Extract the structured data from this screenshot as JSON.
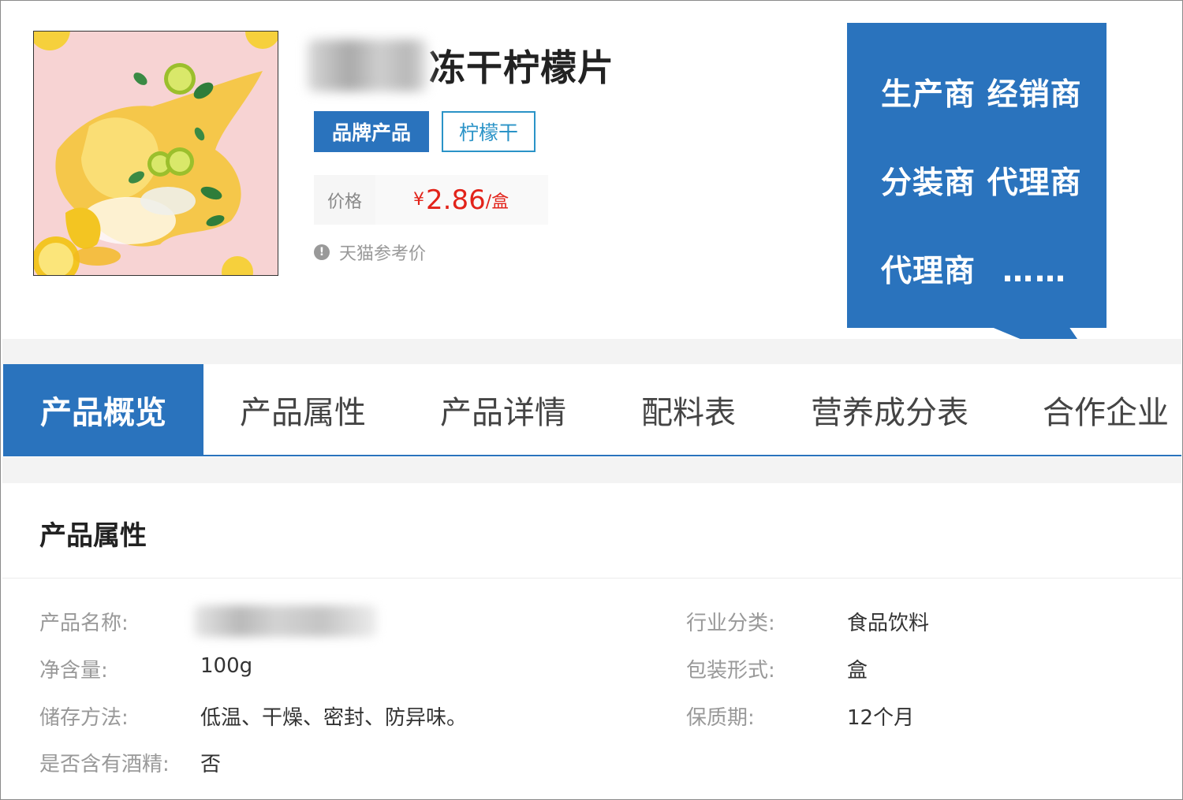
{
  "product": {
    "title": "冻干柠檬片",
    "tags": {
      "brand": "品牌产品",
      "category": "柠檬干"
    },
    "price": {
      "label": "价格",
      "currency": "¥",
      "amount": "2.86",
      "unit": "/盒"
    },
    "price_note": "天猫参考价",
    "info_icon_glyph": "!"
  },
  "callout": {
    "line1": "生产商 经销商",
    "line2": "分装商 代理商",
    "line3": "代理商",
    "dots": "……",
    "color": "#2a73bd"
  },
  "tabs": [
    {
      "label": "产品概览",
      "active": true
    },
    {
      "label": "产品属性",
      "active": false
    },
    {
      "label": "产品详情",
      "active": false
    },
    {
      "label": "配料表",
      "active": false
    },
    {
      "label": "营养成分表",
      "active": false
    },
    {
      "label": "合作企业",
      "active": false
    }
  ],
  "properties": {
    "title": "产品属性",
    "rows": [
      {
        "label": "产品名称:",
        "value": ""
      },
      {
        "label": "行业分类:",
        "value": "食品饮料"
      },
      {
        "label": "净含量:",
        "value": "100g"
      },
      {
        "label": "包装形式:",
        "value": "盒"
      },
      {
        "label": "储存方法:",
        "value": "低温、干燥、密封、防异味。"
      },
      {
        "label": "保质期:",
        "value": "12个月"
      },
      {
        "label": "是否含有酒精:",
        "value": "否"
      }
    ]
  },
  "colors": {
    "accent": "#2a73bd",
    "price_red": "#e2231a",
    "tag_outline": "#2a93c7"
  }
}
